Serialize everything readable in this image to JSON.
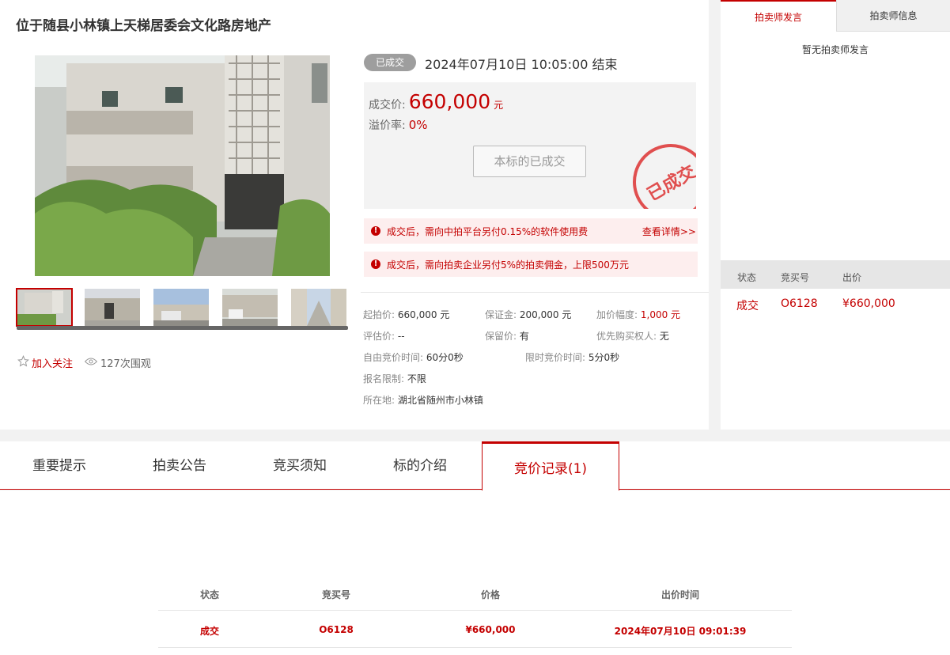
{
  "title": "位于随县小林镇上天梯居委会文化路房地产",
  "gallery": {
    "thumb_count": 5
  },
  "actions": {
    "follow": "加入关注",
    "views": "127次围观"
  },
  "status": {
    "badge": "已成交",
    "end_time": "2024年07月10日  10:05:00 结束",
    "deal_price_label": "成交价:",
    "deal_price": "660,000",
    "deal_price_unit": "元",
    "premium_label": "溢价率:",
    "premium": "0%",
    "done_button": "本标的已成交",
    "stamp": "已成交"
  },
  "notices": [
    {
      "text": "成交后，需向中拍平台另付0.15%的软件使用费",
      "link": "查看详情>>"
    },
    {
      "text": "成交后，需向拍卖企业另付5%的拍卖佣金，上限500万元",
      "link": ""
    }
  ],
  "details": {
    "start_price_k": "起拍价:",
    "start_price_v": "660,000 元",
    "deposit_k": "保证金:",
    "deposit_v": "200,000 元",
    "increment_k": "加价幅度:",
    "increment_v": "1,000 元",
    "appraise_k": "评估价:",
    "appraise_v": "--",
    "reserve_k": "保留价:",
    "reserve_v": "有",
    "priority_k": "优先购买权人:",
    "priority_v": "无",
    "free_time_k": "自由竞价时间:",
    "free_time_v": "60分0秒",
    "limit_time_k": "限时竞价时间:",
    "limit_time_v": "5分0秒",
    "signup_k": "报名限制:",
    "signup_v": "不限",
    "location_k": "所在地:",
    "location_v": "湖北省随州市小林镇"
  },
  "side": {
    "tab_speech": "拍卖师发言",
    "tab_info": "拍卖师信息",
    "empty": "暂无拍卖师发言",
    "headers": [
      "状态",
      "竞买号",
      "出价"
    ],
    "row": [
      "成交",
      "O6128",
      "¥660,000"
    ]
  },
  "tabs": [
    "重要提示",
    "拍卖公告",
    "竞买须知",
    "标的介绍",
    "竞价记录(1)"
  ],
  "bids": {
    "headers": [
      "状态",
      "竞买号",
      "价格",
      "出价时间"
    ],
    "rows": [
      [
        "成交",
        "O6128",
        "¥660,000",
        "2024年07月10日  09:01:39"
      ]
    ]
  },
  "colors": {
    "accent": "#c40000",
    "badge": "#9e9e9e"
  }
}
